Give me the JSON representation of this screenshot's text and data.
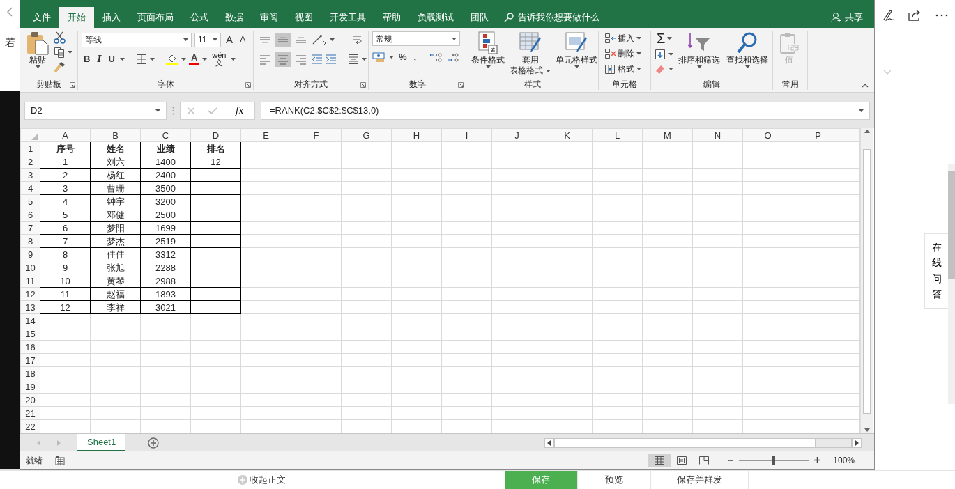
{
  "background": {
    "side_text": "若",
    "help_tab": "在线问答"
  },
  "tabs": [
    {
      "label": "文件",
      "selected": false
    },
    {
      "label": "开始",
      "selected": true
    },
    {
      "label": "插入",
      "selected": false
    },
    {
      "label": "页面布局",
      "selected": false
    },
    {
      "label": "公式",
      "selected": false
    },
    {
      "label": "数据",
      "selected": false
    },
    {
      "label": "审阅",
      "selected": false
    },
    {
      "label": "视图",
      "selected": false
    },
    {
      "label": "开发工具",
      "selected": false
    },
    {
      "label": "帮助",
      "selected": false
    },
    {
      "label": "负载测试",
      "selected": false
    },
    {
      "label": "团队",
      "selected": false
    }
  ],
  "tell_me": "告诉我你想要做什么",
  "share": "共享",
  "ribbon": {
    "groups": [
      {
        "kind": "clipboard",
        "label": "剪贴板",
        "paste": "粘贴"
      },
      {
        "kind": "font",
        "label": "字体",
        "font": "等线",
        "size": "11",
        "grow": "A",
        "shrink": "A",
        "styles": [
          "B",
          "I",
          "U"
        ],
        "font_color": "A",
        "phonetic_top": "wén",
        "phonetic_bottom": "文"
      },
      {
        "kind": "alignment",
        "label": "对齐方式",
        "vertical": [
          {
            "selected": false
          },
          {
            "selected": true
          },
          {
            "selected": false
          }
        ],
        "horizontal": [
          {
            "selected": false
          },
          {
            "selected": true
          },
          {
            "selected": false
          }
        ]
      },
      {
        "kind": "number",
        "label": "数字",
        "format": "常规",
        "percent": "%",
        "comma": ","
      },
      {
        "kind": "styles",
        "label": "样式",
        "buttons": [
          [
            "条件格式"
          ],
          [
            "套用",
            "表格格式"
          ],
          [
            "单元格样式"
          ]
        ]
      },
      {
        "kind": "cells",
        "label": "单元格",
        "buttons": [
          "插入",
          "删除",
          "格式"
        ]
      },
      {
        "kind": "editing",
        "label": "编辑",
        "sum": "Σ",
        "buttons": [
          "排序和筛选",
          "查找和选择"
        ]
      },
      {
        "kind": "common",
        "label": "常用",
        "button": "值",
        "disabled": true
      }
    ]
  },
  "formula_bar": {
    "name_box": "D2",
    "fx": "fx",
    "formula": "=RANK(C2,$C$2:$C$13,0)"
  },
  "sheet": {
    "columns": [
      "A",
      "B",
      "C",
      "D",
      "E",
      "F",
      "G",
      "H",
      "I",
      "J",
      "K",
      "L",
      "M",
      "N",
      "O",
      "P"
    ],
    "row_numbers": [
      "1",
      "2",
      "3",
      "4",
      "5",
      "6",
      "7",
      "8",
      "9",
      "10",
      "11",
      "12",
      "13",
      "14",
      "15",
      "16",
      "17",
      "18",
      "19",
      "20",
      "21",
      "22"
    ],
    "rows": [
      [
        "序号",
        "姓名",
        "业绩",
        "排名"
      ],
      [
        "1",
        "刘六",
        "1400",
        "12"
      ],
      [
        "2",
        "杨红",
        "2400",
        ""
      ],
      [
        "3",
        "曹珊",
        "3500",
        ""
      ],
      [
        "4",
        "钟宇",
        "3200",
        ""
      ],
      [
        "5",
        "邓健",
        "2500",
        ""
      ],
      [
        "6",
        "梦阳",
        "1699",
        ""
      ],
      [
        "7",
        "梦杰",
        "2519",
        ""
      ],
      [
        "8",
        "佳佳",
        "3312",
        ""
      ],
      [
        "9",
        "张旭",
        "2288",
        ""
      ],
      [
        "10",
        "黄琴",
        "2988",
        ""
      ],
      [
        "11",
        "赵福",
        "1893",
        ""
      ],
      [
        "12",
        "李祥",
        "3021",
        ""
      ]
    ]
  },
  "sheet_tabs": [
    {
      "label": "Sheet1",
      "selected": true
    }
  ],
  "status_bar": {
    "status": "就绪",
    "views": [
      {
        "kind": "normal",
        "selected": true
      },
      {
        "kind": "page_layout",
        "selected": false
      },
      {
        "kind": "page_break",
        "selected": false
      }
    ],
    "zoom": {
      "level": 0.5
    },
    "zoom_text": "100%"
  },
  "footer": {
    "collapse": "收起正文",
    "buttons": [
      {
        "label": "保存",
        "primary": true
      },
      {
        "label": "预览",
        "primary": false
      },
      {
        "label": "保存并群发",
        "primary": false
      }
    ]
  }
}
